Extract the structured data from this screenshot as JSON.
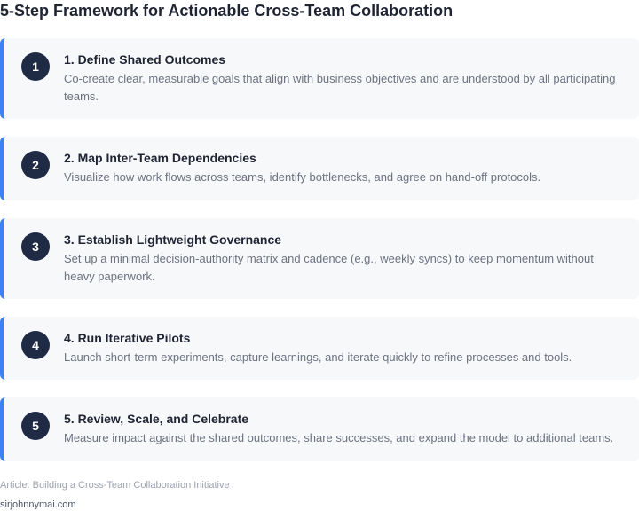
{
  "title": "5-Step Framework for Actionable Cross-Team Collaboration",
  "steps": [
    {
      "number": "1",
      "title": "1. Define Shared Outcomes",
      "description": "Co-create clear, measurable goals that align with business objectives and are understood by all participating teams."
    },
    {
      "number": "2",
      "title": "2. Map Inter-Team Dependencies",
      "description": "Visualize how work flows across teams, identify bottlenecks, and agree on hand-off protocols."
    },
    {
      "number": "3",
      "title": "3. Establish Lightweight Governance",
      "description": "Set up a minimal decision-authority matrix and cadence (e.g., weekly syncs) to keep momentum without heavy paperwork."
    },
    {
      "number": "4",
      "title": "4. Run Iterative Pilots",
      "description": "Launch short-term experiments, capture learnings, and iterate quickly to refine processes and tools."
    },
    {
      "number": "5",
      "title": "5. Review, Scale, and Celebrate",
      "description": "Measure impact against the shared outcomes, share successes, and expand the model to additional teams."
    }
  ],
  "footer": {
    "article": "Article: Building a Cross-Team Collaboration Initiative",
    "site": "sirjohnnymai.com"
  },
  "colors": {
    "accent": "#3b82f6",
    "badge": "#1f2a44",
    "card_background": "#f7f8fa"
  }
}
